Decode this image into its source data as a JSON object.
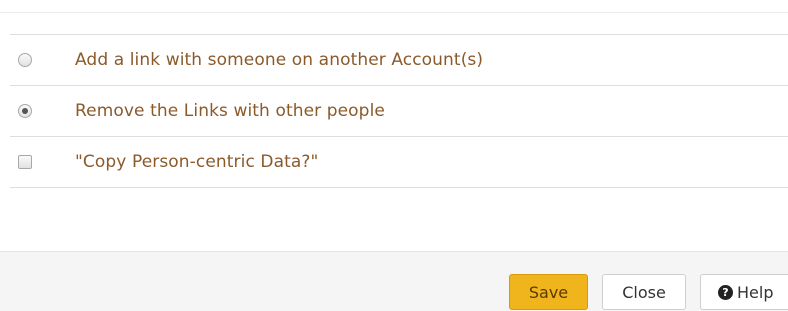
{
  "options": [
    {
      "type": "radio",
      "checked": false,
      "label": "Add a link with someone on another Account(s)"
    },
    {
      "type": "radio",
      "checked": true,
      "label": "Remove the Links with other people"
    },
    {
      "type": "checkbox",
      "checked": false,
      "label": "\"Copy Person-centric Data?\""
    }
  ],
  "footer": {
    "save_label": "Save",
    "close_label": "Close",
    "help_label": "Help",
    "help_icon": "question-circle-icon"
  },
  "colors": {
    "label_text": "#8b5a2b",
    "save_button": "#f0b41c"
  }
}
